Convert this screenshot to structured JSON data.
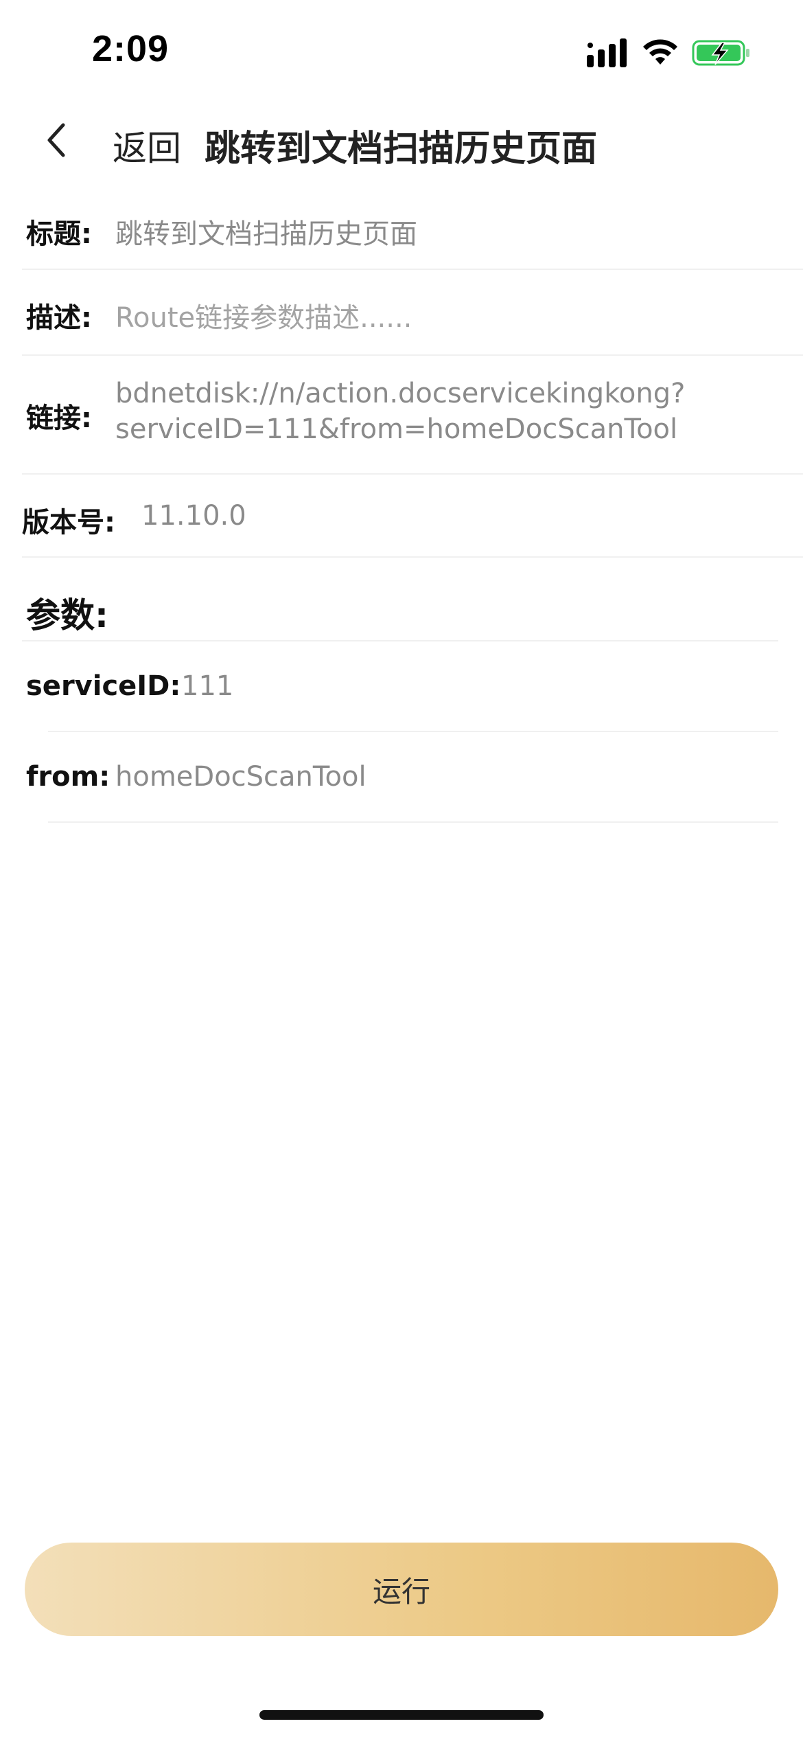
{
  "status_bar": {
    "time": "2:09"
  },
  "nav": {
    "back_label": "返回",
    "title": "跳转到文档扫描历史页面"
  },
  "form": {
    "title_label": "标题:",
    "title_value": "跳转到文档扫描历史页面",
    "desc_label": "描述:",
    "desc_placeholder": "Route链接参数描述......",
    "link_label": "链接:",
    "link_line1": "bdnetdisk://n/action.docservicekingkong?",
    "link_line2": "serviceID=111&from=homeDocScanTool",
    "version_label": "版本号:",
    "version_value": "11.10.0"
  },
  "params": {
    "title": "参数:",
    "items": [
      {
        "key": "serviceID:",
        "value": "111"
      },
      {
        "key": "from:",
        "value": "homeDocScanTool"
      }
    ]
  },
  "run_button": {
    "label": "运行"
  },
  "colors": {
    "accent_start": "#f3dfb9",
    "accent_end": "#e6b86c",
    "battery_green": "#34c759",
    "placeholder_gray": "#8a8a8a"
  }
}
